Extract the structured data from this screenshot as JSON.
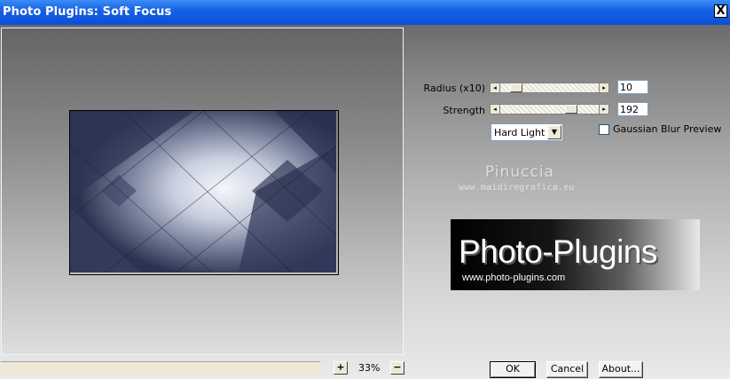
{
  "window": {
    "title": "Photo Plugins: Soft Focus",
    "close_label": "X"
  },
  "controls": {
    "radius": {
      "label": "Radius (x10)",
      "value": "10",
      "level_fraction": 0.12
    },
    "strength": {
      "label": "Strength",
      "value": "192",
      "level_fraction": 0.75
    },
    "blend_mode": {
      "selected": "Hard Light"
    },
    "gaussian_preview": {
      "label": "Gaussian Blur Preview",
      "checked": false
    }
  },
  "zoom": {
    "plus": "+",
    "minus": "−",
    "value": "33%"
  },
  "watermark": {
    "name": "Pinuccia",
    "url": "www.maidiregrafica.eu"
  },
  "logo": {
    "title": "Photo-Plugins",
    "url": "www.photo-plugins.com"
  },
  "buttons": {
    "ok": "OK",
    "cancel": "Cancel",
    "about": "About..."
  },
  "icons": {
    "arrow_left": "◂",
    "arrow_right": "▸",
    "dropdown": "▼"
  },
  "colors": {
    "title_bar": "#0a4fd6",
    "preview_tint": "#3b4563"
  }
}
